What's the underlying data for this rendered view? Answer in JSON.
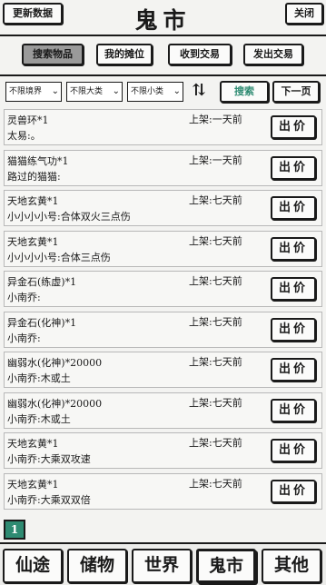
{
  "header": {
    "refresh_label": "更新数据",
    "title": "鬼市",
    "close_label": "关闭"
  },
  "tabs": [
    {
      "label": "搜索物品",
      "active": true
    },
    {
      "label": "我的摊位",
      "active": false
    },
    {
      "label": "收到交易",
      "active": false
    },
    {
      "label": "发出交易",
      "active": false
    }
  ],
  "filters": {
    "realm": "不限境界",
    "category": "不限大类",
    "subcategory": "不限小类",
    "sort_icon": "sort-arrows-icon",
    "search_label": "搜索",
    "next_page_label": "下一页"
  },
  "listings": [
    {
      "name": "灵兽环*1",
      "owner": "太易:。",
      "time": "上架:一天前",
      "action": "出价"
    },
    {
      "name": "猫猫练气功*1",
      "owner": "路过的猫猫:",
      "time": "上架:一天前",
      "action": "出价"
    },
    {
      "name": "天地玄黄*1",
      "owner": "小小小小号:合体双火三点伤",
      "time": "上架:七天前",
      "action": "出价"
    },
    {
      "name": "天地玄黄*1",
      "owner": "小小小小号:合体三点伤",
      "time": "上架:七天前",
      "action": "出价"
    },
    {
      "name": "异金石(练虚)*1",
      "owner": "小南乔:",
      "time": "上架:七天前",
      "action": "出价"
    },
    {
      "name": "异金石(化神)*1",
      "owner": "小南乔:",
      "time": "上架:七天前",
      "action": "出价"
    },
    {
      "name": "幽弱水(化神)*20000",
      "owner": "小南乔:木或土",
      "time": "上架:七天前",
      "action": "出价"
    },
    {
      "name": "幽弱水(化神)*20000",
      "owner": "小南乔:木或土",
      "time": "上架:七天前",
      "action": "出价"
    },
    {
      "name": "天地玄黄*1",
      "owner": "小南乔:大乘双攻速",
      "time": "上架:七天前",
      "action": "出价"
    },
    {
      "name": "天地玄黄*1",
      "owner": "小南乔:大乘双双倍",
      "time": "上架:七天前",
      "action": "出价"
    }
  ],
  "page_indicator": "1",
  "bottom_nav": [
    {
      "label": "仙途",
      "active": false
    },
    {
      "label": "储物",
      "active": false
    },
    {
      "label": "世界",
      "active": false
    },
    {
      "label": "鬼市",
      "active": true
    },
    {
      "label": "其他",
      "active": false
    }
  ],
  "colors": {
    "accent": "#2e8b72",
    "ink": "#1a1a1a",
    "active_tab": "#9a9a9a"
  }
}
